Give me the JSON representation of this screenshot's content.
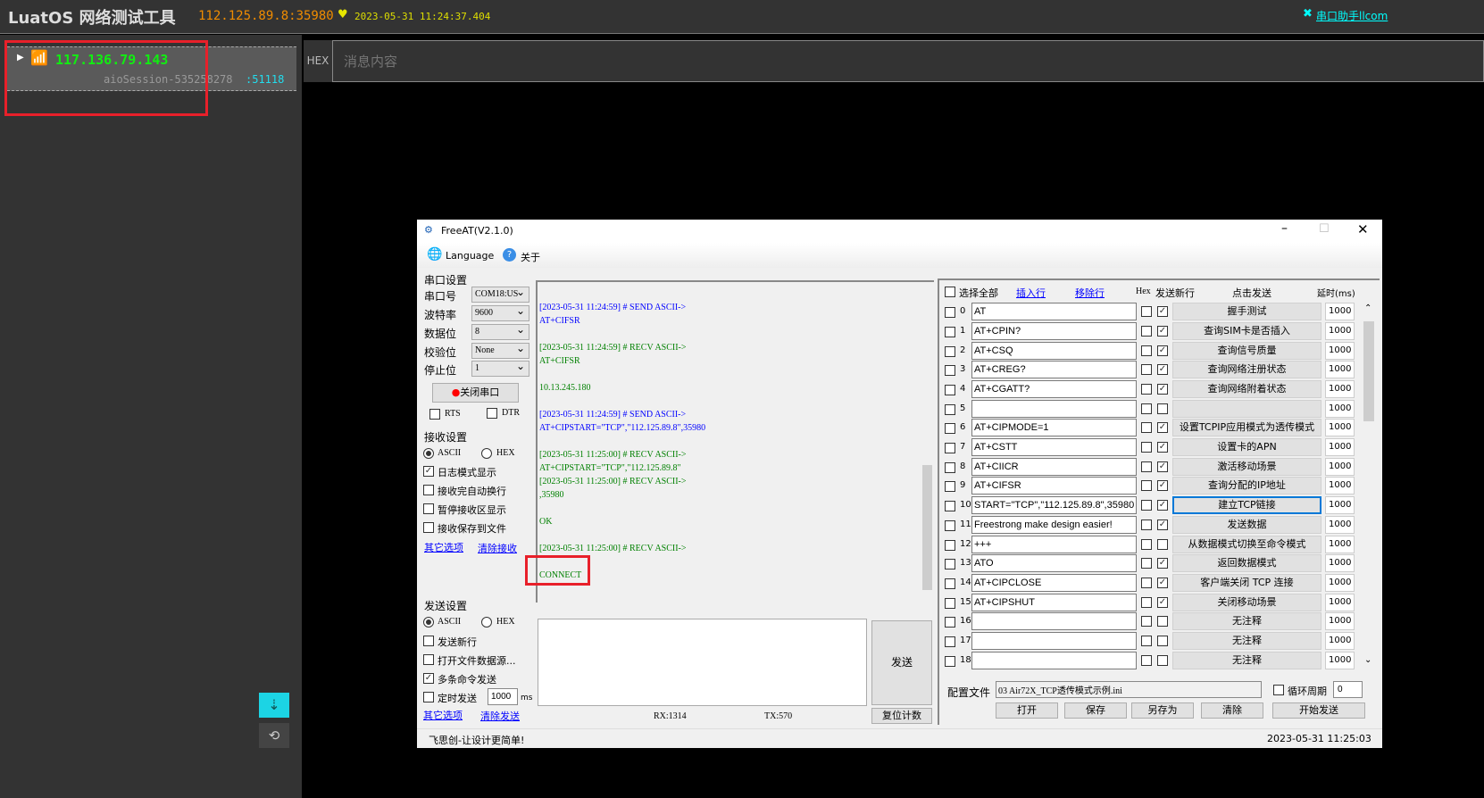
{
  "topbar": {
    "app_title": "LuatOS 网络测试工具",
    "server": "112.125.89.8:35980",
    "timestamp": "2023-05-31 11:24:37.404",
    "link": "串口助手llcom",
    "heart_color": "#e6e600"
  },
  "session": {
    "ip": "117.136.79.143",
    "name": "aioSession-535258278",
    "port": ":51118"
  },
  "message": {
    "hex_label": "HEX",
    "placeholder": "消息内容"
  },
  "freeat": {
    "title": "FreeAT(V2.1.0)",
    "menu": {
      "language": "Language",
      "about": "关于"
    },
    "serial": {
      "section": "串口设置",
      "port_label": "串口号",
      "port": "COM18:US",
      "baud_label": "波特率",
      "baud": "9600",
      "data_label": "数据位",
      "data": "8",
      "parity_label": "校验位",
      "parity": "None",
      "stop_label": "停止位",
      "stop": "1",
      "close_btn": "关闭串口",
      "rts": "RTS",
      "dtr": "DTR"
    },
    "recv": {
      "section": "接收设置",
      "ascii": "ASCII",
      "hex": "HEX",
      "log_mode": "日志模式显示",
      "auto_newline": "接收完自动换行",
      "pause": "暂停接收区显示",
      "save_file": "接收保存到文件",
      "more": "其它选项",
      "clear": "清除接收"
    },
    "send": {
      "section": "发送设置",
      "ascii": "ASCII",
      "hex": "HEX",
      "newline": "发送新行",
      "open_file": "打开文件数据源...",
      "multi": "多条命令发送",
      "timer": "定时发送",
      "timer_value": "1000",
      "ms": "ms",
      "more": "其它选项",
      "clear": "清除发送",
      "send_btn": "发送",
      "reset_btn": "复位计数",
      "rx": "RX:1314",
      "tx": "TX:570"
    },
    "log": [
      {
        "t": "",
        "c": "g"
      },
      {
        "t": "[2023-05-31 11:24:59] # SEND ASCII->",
        "c": "b"
      },
      {
        "t": "AT+CIFSR",
        "c": "b"
      },
      {
        "t": "",
        "c": "g"
      },
      {
        "t": "[2023-05-31 11:24:59] # RECV ASCII->",
        "c": "g"
      },
      {
        "t": "AT+CIFSR",
        "c": "g"
      },
      {
        "t": "",
        "c": "g"
      },
      {
        "t": "10.13.245.180",
        "c": "g"
      },
      {
        "t": "",
        "c": "g"
      },
      {
        "t": "[2023-05-31 11:24:59] # SEND ASCII->",
        "c": "b"
      },
      {
        "t": "AT+CIPSTART=\"TCP\",\"112.125.89.8\",35980",
        "c": "b"
      },
      {
        "t": "",
        "c": "g"
      },
      {
        "t": "[2023-05-31 11:25:00] # RECV ASCII->",
        "c": "g"
      },
      {
        "t": "AT+CIPSTART=\"TCP\",\"112.125.89.8\"",
        "c": "g"
      },
      {
        "t": "[2023-05-31 11:25:00] # RECV ASCII->",
        "c": "g"
      },
      {
        "t": ",35980",
        "c": "g"
      },
      {
        "t": "",
        "c": "g"
      },
      {
        "t": "OK",
        "c": "g"
      },
      {
        "t": "",
        "c": "g"
      },
      {
        "t": "[2023-05-31 11:25:00] # RECV ASCII->",
        "c": "g"
      },
      {
        "t": "",
        "c": "g"
      },
      {
        "t": "CONNECT",
        "c": "g"
      }
    ],
    "cmds_header": {
      "select_all": "选择全部",
      "insert": "插入行",
      "remove": "移除行",
      "hex": "Hex",
      "newline": "发送新行",
      "click_send": "点击发送",
      "delay": "延时(ms)"
    },
    "cmds": [
      {
        "i": "0",
        "cmd": "AT",
        "nl": true,
        "btn": "握手测试",
        "d": "1000"
      },
      {
        "i": "1",
        "cmd": "AT+CPIN?",
        "nl": true,
        "btn": "查询SIM卡是否插入",
        "d": "1000"
      },
      {
        "i": "2",
        "cmd": "AT+CSQ",
        "nl": true,
        "btn": "查询信号质量",
        "d": "1000"
      },
      {
        "i": "3",
        "cmd": "AT+CREG?",
        "nl": true,
        "btn": "查询网络注册状态",
        "d": "1000"
      },
      {
        "i": "4",
        "cmd": "AT+CGATT?",
        "nl": true,
        "btn": "查询网络附着状态",
        "d": "1000"
      },
      {
        "i": "5",
        "cmd": "",
        "nl": false,
        "btn": "",
        "d": "1000"
      },
      {
        "i": "6",
        "cmd": "AT+CIPMODE=1",
        "nl": true,
        "btn": "设置TCPIP应用模式为透传模式",
        "d": "1000"
      },
      {
        "i": "7",
        "cmd": "AT+CSTT",
        "nl": true,
        "btn": "设置卡的APN",
        "d": "1000"
      },
      {
        "i": "8",
        "cmd": "AT+CIICR",
        "nl": true,
        "btn": "激活移动场景",
        "d": "1000"
      },
      {
        "i": "9",
        "cmd": "AT+CIFSR",
        "nl": true,
        "btn": "查询分配的IP地址",
        "d": "1000"
      },
      {
        "i": "10",
        "cmd": "START=\"TCP\",\"112.125.89.8\",35980",
        "nl": true,
        "btn": "建立TCP链接",
        "d": "1000",
        "focus": true
      },
      {
        "i": "11",
        "cmd": "Freestrong make design easier!",
        "nl": true,
        "btn": "发送数据",
        "d": "1000"
      },
      {
        "i": "12",
        "cmd": "+++",
        "nl": false,
        "btn": "从数据模式切换至命令模式",
        "d": "1000"
      },
      {
        "i": "13",
        "cmd": "ATO",
        "nl": true,
        "btn": "返回数据模式",
        "d": "1000"
      },
      {
        "i": "14",
        "cmd": "AT+CIPCLOSE",
        "nl": true,
        "btn": "客户端关闭 TCP 连接",
        "d": "1000"
      },
      {
        "i": "15",
        "cmd": "AT+CIPSHUT",
        "nl": true,
        "btn": "关闭移动场景",
        "d": "1000"
      },
      {
        "i": "16",
        "cmd": "",
        "nl": false,
        "btn": "无注释",
        "d": "1000"
      },
      {
        "i": "17",
        "cmd": "",
        "nl": false,
        "btn": "无注释",
        "d": "1000"
      },
      {
        "i": "18",
        "cmd": "",
        "nl": false,
        "btn": "无注释",
        "d": "1000"
      }
    ],
    "config": {
      "label": "配置文件",
      "file": "03 Air72X_TCP透传模式示例.ini",
      "loop": "循环周期",
      "loop_value": "0",
      "open": "打开",
      "save": "保存",
      "save_as": "另存为",
      "clear": "清除",
      "start": "开始发送"
    },
    "status": {
      "slogan": "飞思创-让设计更简单!",
      "time": "2023-05-31 11:25:03"
    }
  }
}
